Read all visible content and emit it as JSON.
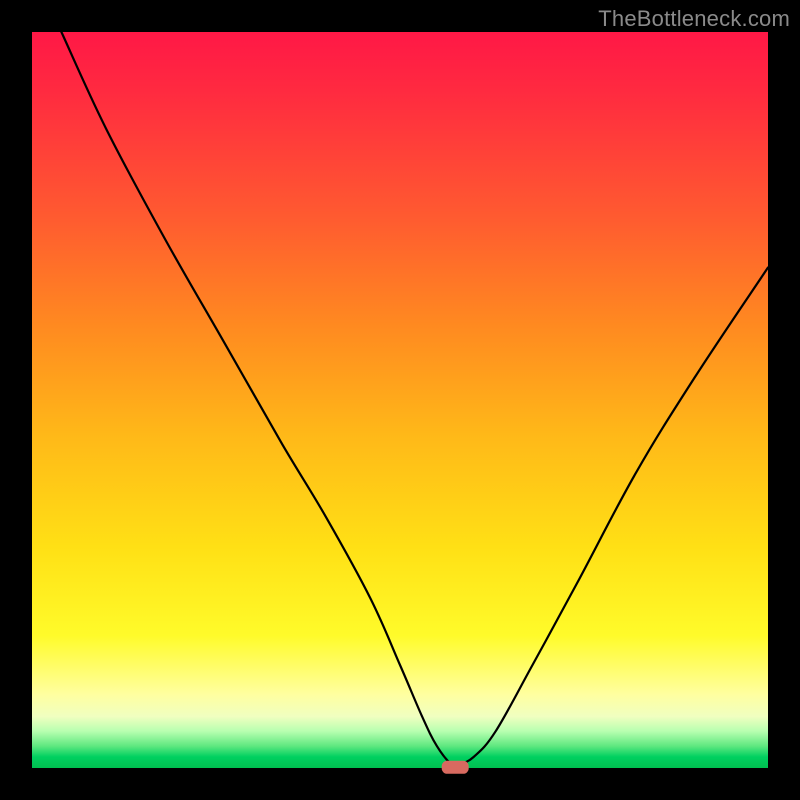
{
  "watermark": "TheBottleneck.com",
  "colors": {
    "frame": "#000000",
    "gradient_top": "#ff1846",
    "gradient_mid1": "#ff8a20",
    "gradient_mid2": "#ffe015",
    "gradient_bottom": "#00c050",
    "curve": "#000000",
    "marker": "#d86a60",
    "watermark_text": "#8a8a8a"
  },
  "chart_data": {
    "type": "line",
    "title": "",
    "xlabel": "",
    "ylabel": "",
    "xlim": [
      0,
      100
    ],
    "ylim": [
      0,
      100
    ],
    "grid": false,
    "legend": false,
    "series": [
      {
        "name": "curve",
        "x": [
          4,
          10,
          18,
          26,
          34,
          40,
          46,
          50,
          53,
          55,
          57,
          58,
          60,
          63,
          68,
          74,
          82,
          90,
          100
        ],
        "y": [
          100,
          87,
          72,
          58,
          44,
          34,
          23,
          14,
          7,
          3,
          0.5,
          0.5,
          1.5,
          5,
          14,
          25,
          40,
          53,
          68
        ]
      }
    ],
    "marker": {
      "x": 57.5,
      "y": 0.1,
      "shape": "rounded-pill"
    },
    "notes": "V-shaped bottleneck curve over rainbow gradient background; minimum near x≈57."
  }
}
